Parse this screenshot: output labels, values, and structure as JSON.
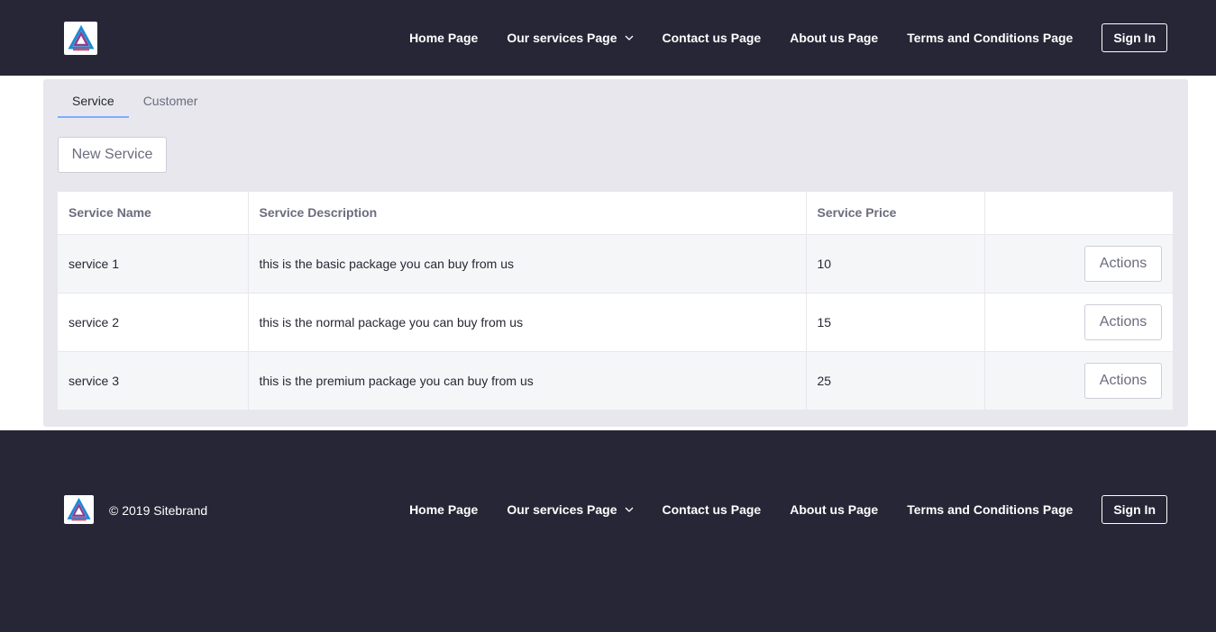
{
  "header": {
    "nav": [
      "Home Page",
      "Our services Page",
      "Contact us Page",
      "About us Page",
      "Terms and Conditions Page"
    ],
    "signin": "Sign In"
  },
  "tabs": [
    "Service",
    "Customer"
  ],
  "new_button": "New Service",
  "table": {
    "headers": [
      "Service Name",
      "Service Description",
      "Service Price",
      ""
    ],
    "rows": [
      {
        "name": "service 1",
        "description": "this is the basic package you can buy from us",
        "price": "10",
        "action": "Actions"
      },
      {
        "name": "service 2",
        "description": "this is the normal package you can buy from us",
        "price": "15",
        "action": "Actions"
      },
      {
        "name": "service 3",
        "description": "this is the premium package you can buy from us",
        "price": "25",
        "action": "Actions"
      }
    ]
  },
  "footer": {
    "copyright": "© 2019 Sitebrand",
    "nav": [
      "Home Page",
      "Our services Page",
      "Contact us Page",
      "About us Page",
      "Terms and Conditions Page"
    ],
    "signin": "Sign In"
  },
  "icons": {
    "logo": "brand-logo-icon",
    "dropdown": "chevron-down-icon"
  },
  "colors": {
    "dark_bg": "#262636",
    "panel_bg": "#e7e7ed",
    "tab_underline": "#80acff"
  }
}
